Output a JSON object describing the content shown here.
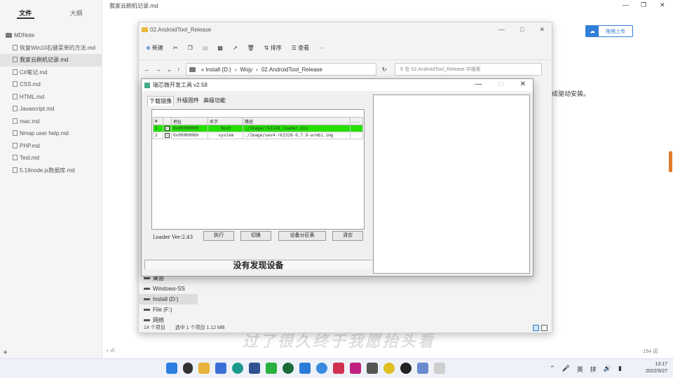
{
  "mdnote": {
    "tabs": [
      "文件",
      "大纲"
    ],
    "root": "MDNote",
    "files": [
      "恢复Win10右键菜单的方法.md",
      "我家云刷机记录.md",
      "C#笔记.md",
      "CSS.md",
      "HTML.md",
      "Javascript.md",
      "mac.md",
      "Nmap user help.md",
      "PHP.md",
      "Test.md",
      "5.19node.js数据库.md"
    ],
    "selected_index": 1,
    "doc_title": "我家云刷机记录.md",
    "upload_label": "拖拽上传",
    "doc_text": "成驱动安装。",
    "word_count": "154 词",
    "add_label": "+",
    "nav_label": "‹  ‹/›"
  },
  "explorer": {
    "title": "02.AndroidTool_Release",
    "toolbar": [
      "新建",
      "排序",
      "查看",
      "···"
    ],
    "address": [
      "« Install (D:)",
      "Wojy",
      "02.AndroidTool_Release"
    ],
    "search_placeholder": "在 02.AndroidTool_Release 中搜索",
    "nav_items": [
      "桌面",
      "Windows-SS",
      "Install (D:)",
      "File (F:)",
      "网络"
    ],
    "status_items": "14 个项目",
    "status_selected": "选中 1 个项目  1.12 MB"
  },
  "tool": {
    "title": "瑞芯微开发工具 v2.58",
    "tabs": [
      "下载镜像",
      "升级固件",
      "高级功能"
    ],
    "columns": [
      "#",
      "",
      "地址",
      "名字",
      "路径",
      "..."
    ],
    "rows": [
      {
        "idx": "1",
        "addr": "0x00000000",
        "name": "Boot",
        "path": "./Image/rk3328_loader.bin"
      },
      {
        "idx": "2",
        "addr": "0x00000000",
        "name": "system",
        "path": "./Image/sev4-rk3328-0.7.9-armbi.img"
      }
    ],
    "loader": "Loader Ver:2.43",
    "buttons": [
      "执行",
      "切换",
      "设备分区表",
      "清空"
    ],
    "status": "没有发现设备"
  },
  "watermark": "过了很久终于我愿抬头看",
  "taskbar": {
    "tray_lang": "英",
    "tray_ime": "拼",
    "time": "13:17",
    "date": "2022/5/27"
  },
  "colors": {
    "accent": "#2f7fd6",
    "highlight": "#22e000"
  }
}
